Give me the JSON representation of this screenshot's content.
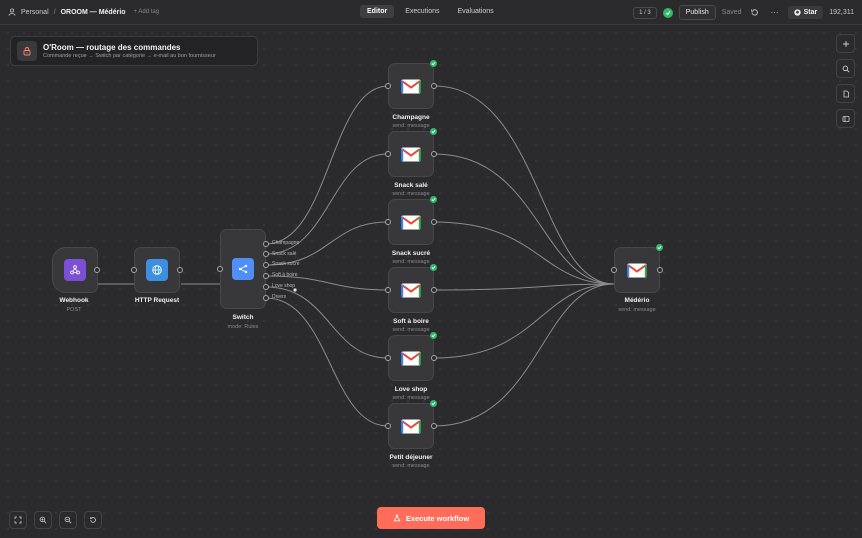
{
  "topbar": {
    "owner": "Personal",
    "separator": "/",
    "workflow_name": "OROOM — Médério",
    "add_tag": "+ Add tag",
    "tabs": [
      {
        "label": "Editor",
        "active": true
      },
      {
        "label": "Executions",
        "active": false
      },
      {
        "label": "Evaluations",
        "active": false
      }
    ],
    "pager": "1 / 3",
    "publish_label": "Publish",
    "saved_label": "Saved",
    "more_label": "···",
    "star_label": "Star",
    "star_count": "192,311"
  },
  "sticky": {
    "title": "O'Room — routage des commandes",
    "subtitle": "Commande reçue → Switch par catégorie → e-mail au bon fournisseur"
  },
  "nodes": {
    "webhook": {
      "label": "Webhook",
      "sub": "POST"
    },
    "http": {
      "label": "HTTP Request"
    },
    "switch": {
      "label": "Switch",
      "sub": "mode: Rules",
      "outputs": [
        "Champagne",
        "Snack salé",
        "Snack sucré",
        "Soft à boire",
        "Love shop",
        "Divers"
      ]
    },
    "gmail": [
      {
        "label": "Champagne",
        "sub": "send: message"
      },
      {
        "label": "Snack salé",
        "sub": "send: message"
      },
      {
        "label": "Snack sucré",
        "sub": "send: message"
      },
      {
        "label": "Soft à boire",
        "sub": "send: message"
      },
      {
        "label": "Love shop",
        "sub": "send: message"
      },
      {
        "label": "Petit déjeuner",
        "sub": "send: message"
      }
    ],
    "mederio": {
      "label": "Médério",
      "sub": "send: message"
    }
  },
  "execute": {
    "label": "Execute workflow"
  },
  "colors": {
    "accent": "#ff6d5a",
    "success": "#2fb96a",
    "webhook": "#7b4fd6",
    "http": "#3d8fe0",
    "switch": "#4f8ff7"
  }
}
